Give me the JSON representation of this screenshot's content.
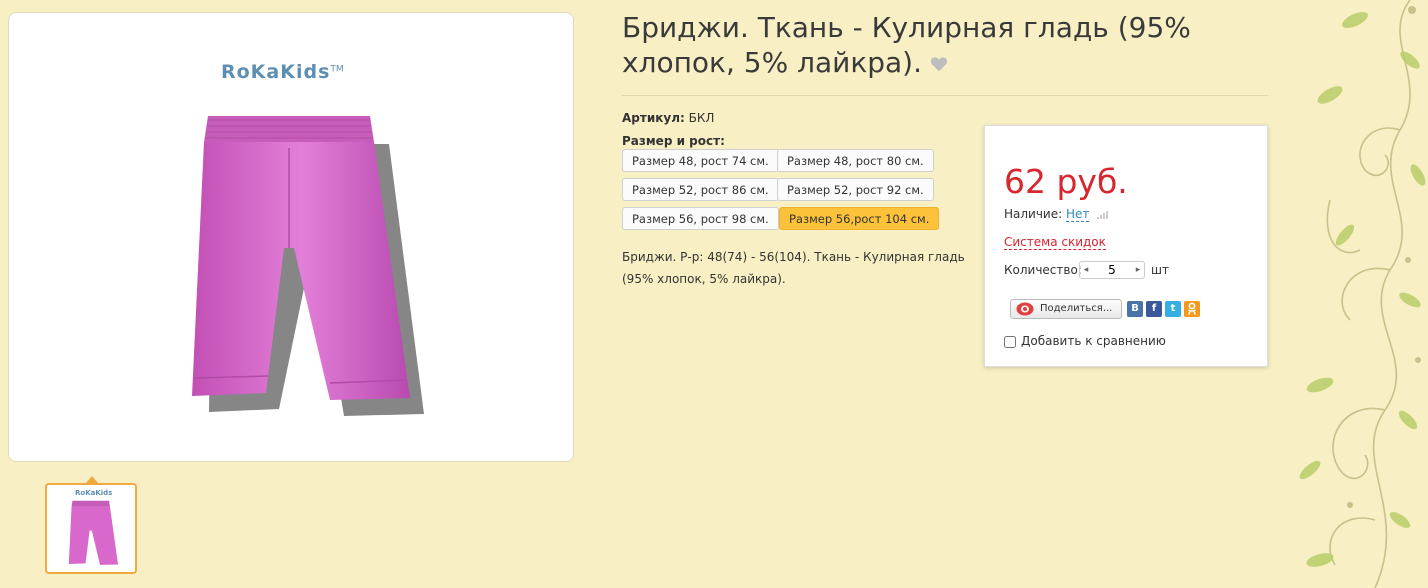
{
  "product": {
    "title": "Бриджи. Ткань - Кулирная гладь (95% хлопок, 5% лайкра).",
    "article_label": "Артикул:",
    "article_value": "БКЛ",
    "sizes_label": "Размер и рост:",
    "sizes": [
      {
        "label": "Размер 48, рост 74 см.",
        "selected": false
      },
      {
        "label": "Размер 48, рост 80 см.",
        "selected": false
      },
      {
        "label": "Размер 52, рост 86 см.",
        "selected": false
      },
      {
        "label": "Размер 52, рост 92 см.",
        "selected": false
      },
      {
        "label": "Размер 56, рост 98 см.",
        "selected": false
      },
      {
        "label": "Размер 56,рост 104 см.",
        "selected": true
      }
    ],
    "description": "Бриджи. Р-р: 48(74) - 56(104). Ткань - Кулирная гладь (95% хлопок, 5% лайкра)."
  },
  "image": {
    "brand": "RoKaKids",
    "trademark": "TM",
    "garment_color": "#d86ac8"
  },
  "purchase": {
    "price": "62 руб.",
    "availability_label": "Наличие:",
    "availability_value": "Нет",
    "discount_link": "Система скидок",
    "quantity_label": "Количество:",
    "quantity_value": "5",
    "quantity_unit": "шт",
    "share_label": "Поделиться...",
    "social": [
      "В",
      "f",
      "t",
      "ok"
    ],
    "compare_label": "Добавить к сравнению"
  },
  "colors": {
    "price_red": "#d8262e",
    "selected_size": "#fcc23a",
    "background": "#f8f0c4",
    "link_blue": "#2d89c7"
  }
}
